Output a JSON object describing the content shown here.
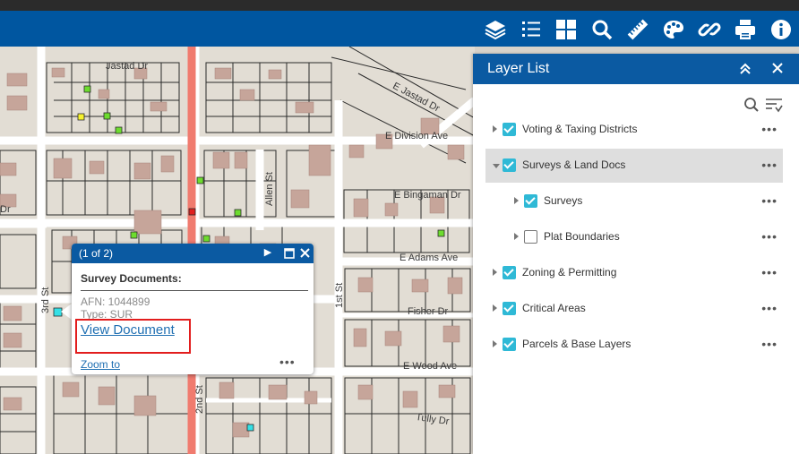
{
  "toolbar": {
    "icons": [
      "layers-icon",
      "legend-icon",
      "grid-icon",
      "search-icon",
      "measure-icon",
      "palette-icon",
      "link-icon",
      "print-icon",
      "info-icon"
    ]
  },
  "map": {
    "streets": {
      "jastad": "Jastad Dr",
      "e_jastad": "E Jastad Dr",
      "division": "E Division Ave",
      "allen": "Allen St",
      "bingaman": "E Bingaman Dr",
      "adams": "E Adams Ave",
      "first": "1st St",
      "third": "3rd St",
      "second": "2nd St",
      "fisher": "Fisher Dr",
      "wood": "E Wood Ave",
      "tully": "Tully Dr",
      "left_dr": "Dr"
    }
  },
  "popup": {
    "counter": "(1 of 2)",
    "title": "Survey Documents:",
    "afn": "AFN: 1044899",
    "type": "Type: SUR",
    "view_link": "View Document",
    "zoom_link": "Zoom to",
    "more": "•••"
  },
  "panel": {
    "title": "Layer List",
    "layers": [
      {
        "label": "Voting & Taxing Districts",
        "checked": true,
        "indent": 0,
        "expanded": false
      },
      {
        "label": "Surveys & Land Docs",
        "checked": true,
        "indent": 0,
        "expanded": true,
        "selected": true
      },
      {
        "label": "Surveys",
        "checked": true,
        "indent": 1,
        "expanded": false
      },
      {
        "label": "Plat Boundaries",
        "checked": false,
        "indent": 1,
        "expanded": false
      },
      {
        "label": "Zoning & Permitting",
        "checked": true,
        "indent": 0,
        "expanded": false
      },
      {
        "label": "Critical Areas",
        "checked": true,
        "indent": 0,
        "expanded": false
      },
      {
        "label": "Parcels & Base Layers",
        "checked": true,
        "indent": 0,
        "expanded": false
      }
    ],
    "more": "•••"
  },
  "colors": {
    "toolbar": "#0056a0",
    "panel_header": "#0b5aa2",
    "checkbox": "#2fb9d6",
    "highway": "#f07b6f"
  }
}
